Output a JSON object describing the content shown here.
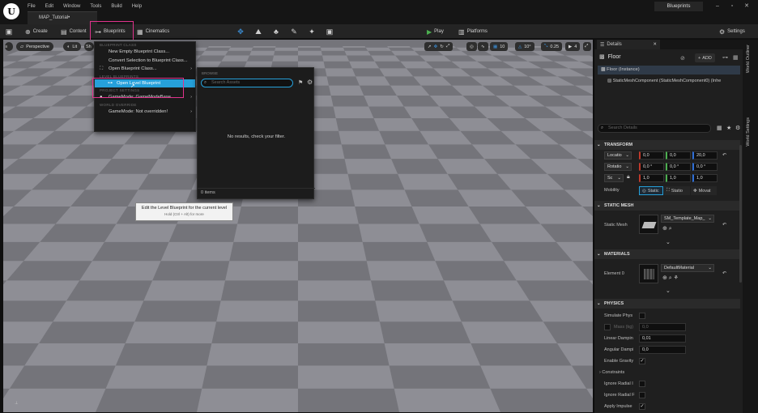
{
  "app": {
    "logo": "U",
    "menu": [
      "File",
      "Edit",
      "Window",
      "Tools",
      "Build",
      "Help"
    ],
    "doc_tab": "MAP_Tutorial•",
    "title": "Blueprints",
    "win_min": "–",
    "win_max": "▫",
    "win_close": "✕"
  },
  "toolbar": {
    "create": "Create",
    "content": "Content",
    "blueprints": "Blueprints",
    "cinematics": "Cinematics",
    "play": "Play",
    "platforms": "Platforms",
    "settings": "Settings"
  },
  "viewport": {
    "perspective": "Perspective",
    "lit": "Lit",
    "show": "Sh",
    "snap": "10",
    "rot": "10°",
    "scale": "0.25",
    "cam": "4"
  },
  "blueprint_menu": {
    "sec_class": "BLUEPRINT CLASS",
    "new_empty": "New Empty Blueprint Class...",
    "convert": "Convert Selection to Blueprint Class...",
    "open_class": "Open Blueprint Class...",
    "sec_level": "LEVEL BLUEPRINTS",
    "open_level": "Open Level Blueprint",
    "sec_project": "PROJECT SETTINGS",
    "gamemode": "GameMode: GameModeBase",
    "sec_world": "WORLD OVERRIDE",
    "gamemode_override": "GameMode: Not overridden!"
  },
  "tooltip": {
    "line1": "Edit the Level Blueprint for the current level",
    "line2": "Hold (Ctrl + Alt) for more"
  },
  "browse": {
    "header": "BROWSE",
    "placeholder": "Search Assets",
    "empty": "No results, check your filter.",
    "count": "0 items"
  },
  "details": {
    "tab": "Details",
    "close": "✕",
    "actor": "Floor",
    "add": "ADD",
    "instance": "Floor (Instance)",
    "component": "StaticMeshComponent (StaticMeshComponent0) (Inhe",
    "search_placeholder": "Search Details",
    "transform": "TRANSFORM",
    "location": "Locatio",
    "rotation": "Rotatio",
    "scale": "Sc",
    "loc": [
      "0,0",
      "0,0",
      "20,0"
    ],
    "rot": [
      "0,0 °",
      "0,0 °",
      "0,0 °"
    ],
    "scl": [
      "1,0",
      "1,0",
      "1,0"
    ],
    "mobility": "Mobility",
    "mob_static": "Static",
    "mob_stationary": "Statio",
    "mob_movable": "Movat",
    "static_mesh_sect": "STATIC MESH",
    "static_mesh": "Static Mesh",
    "mesh_value": "SM_Template_Map_",
    "materials_sect": "MATERIALS",
    "element0": "Element 0",
    "material_value": "DefaultMaterial",
    "physics_sect": "PHYSICS",
    "simulate": "Simulate Phys",
    "mass": "Mass (kg)",
    "mass_value": "0,0",
    "linear": "Linear Dampin",
    "linear_value": "0,01",
    "angular": "Angular Dampi",
    "angular_value": "0,0",
    "gravity": "Enable Gravity",
    "constraints": "Constraints",
    "ignore1": "Ignore Radial I",
    "ignore2": "Ignore Radial F",
    "impulse": "Apply Impulse"
  },
  "side_tabs": {
    "outliner": "World Outliner",
    "settings": "World Settings"
  },
  "colors": {
    "accent": "#26a0da",
    "highlight_box": "#e0338c",
    "play": "#4caf50"
  }
}
